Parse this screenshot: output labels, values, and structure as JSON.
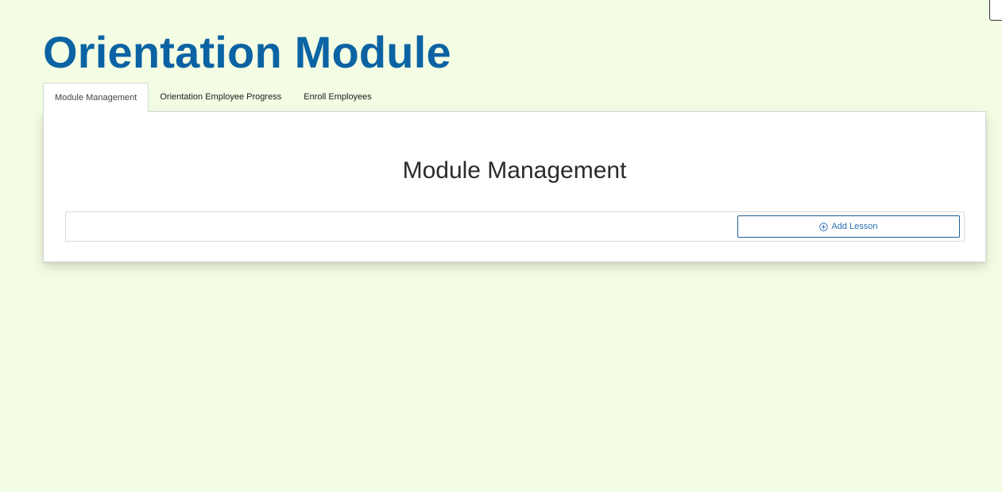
{
  "page": {
    "title": "Orientation Module"
  },
  "tabs": [
    {
      "label": "Module Management",
      "active": true
    },
    {
      "label": "Orientation Employee Progress",
      "active": false
    },
    {
      "label": "Enroll Employees",
      "active": false
    }
  ],
  "panel": {
    "heading": "Module Management",
    "add_button_label": "Add Lesson",
    "add_button_icon": "plus-circle-icon"
  },
  "colors": {
    "background": "#f3fde4",
    "title": "#0b63a3",
    "accent": "#2a6fae"
  }
}
